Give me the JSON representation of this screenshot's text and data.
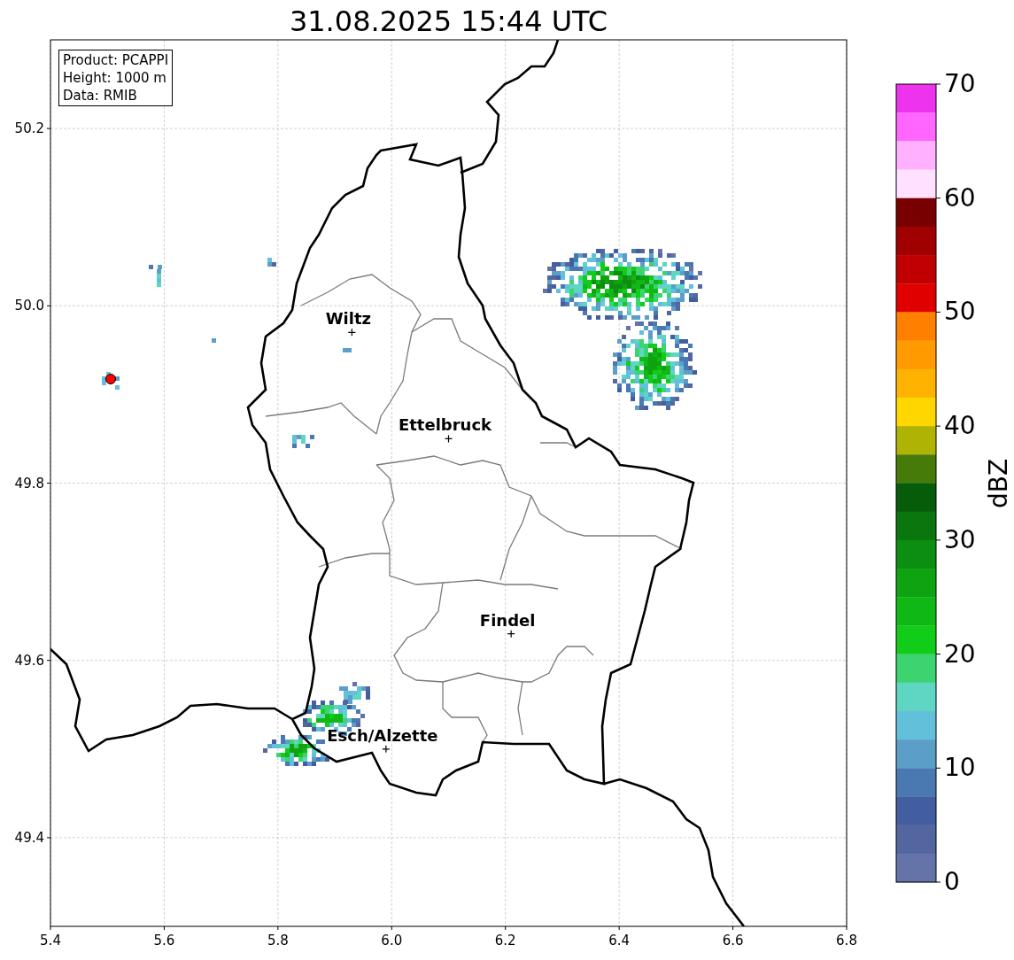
{
  "title": "31.08.2025 15:44 UTC",
  "map": {
    "info_box": [
      "Product: PCAPPI",
      "Height: 1000 m",
      "Data: RMIB"
    ],
    "chart_data": {
      "type": "scatter",
      "grid": true,
      "xlim": [
        5.4,
        6.8
      ],
      "ylim": [
        49.3,
        50.3
      ],
      "xticks": [
        {
          "value": 5.4,
          "label": "5.4"
        },
        {
          "value": 5.6,
          "label": "5.6"
        },
        {
          "value": 5.8,
          "label": "5.8"
        },
        {
          "value": 6.0,
          "label": "6.0"
        },
        {
          "value": 6.2,
          "label": "6.2"
        },
        {
          "value": 6.4,
          "label": "6.4"
        },
        {
          "value": 6.6,
          "label": "6.6"
        },
        {
          "value": 6.8,
          "label": "6.8"
        }
      ],
      "yticks": [
        {
          "value": 49.4,
          "label": "49.4"
        },
        {
          "value": 49.6,
          "label": "49.6"
        },
        {
          "value": 49.8,
          "label": "49.8"
        },
        {
          "value": 50.0,
          "label": "50.0"
        },
        {
          "value": 50.2,
          "label": "50.2"
        }
      ],
      "x": [
        5.93,
        6.1,
        6.21,
        5.99
      ],
      "series": [
        {
          "color": "#000000",
          "values": [
            49.97,
            49.85,
            49.63,
            49.5
          ]
        }
      ],
      "annotations": [
        {
          "text": "Wiltz",
          "x": 5.93,
          "y": 49.97
        },
        {
          "text": "Ettelbruck",
          "x": 6.1,
          "y": 49.85
        },
        {
          "text": "Findel",
          "x": 6.21,
          "y": 49.63
        },
        {
          "text": "Esch/Alzette",
          "x": 5.99,
          "y": 49.5
        }
      ]
    }
  },
  "colorbar": {
    "label": "dBZ",
    "ticks": [
      "70",
      "60",
      "50",
      "40",
      "30",
      "20",
      "10",
      "0"
    ],
    "bands": [
      {
        "color": "#ee33ee"
      },
      {
        "color": "#ff66ff"
      },
      {
        "color": "#ffb0ff"
      },
      {
        "color": "#ffe0ff"
      },
      {
        "color": "#780000"
      },
      {
        "color": "#a00000"
      },
      {
        "color": "#c00000"
      },
      {
        "color": "#e00000"
      },
      {
        "color": "#ff7f00"
      },
      {
        "color": "#ff9a00"
      },
      {
        "color": "#ffb300"
      },
      {
        "color": "#ffd700"
      },
      {
        "color": "#aeb304"
      },
      {
        "color": "#467a09"
      },
      {
        "color": "#075c09"
      },
      {
        "color": "#0a760d"
      },
      {
        "color": "#0c8e10"
      },
      {
        "color": "#0fa312"
      },
      {
        "color": "#10b815"
      },
      {
        "color": "#11cc19"
      },
      {
        "color": "#3cd470"
      },
      {
        "color": "#5fd6c4"
      },
      {
        "color": "#63c0db"
      },
      {
        "color": "#5b9ec8"
      },
      {
        "color": "#4a78b0"
      },
      {
        "color": "#425ea0"
      },
      {
        "color": "#53669f"
      },
      {
        "color": "#6474a8"
      }
    ]
  }
}
